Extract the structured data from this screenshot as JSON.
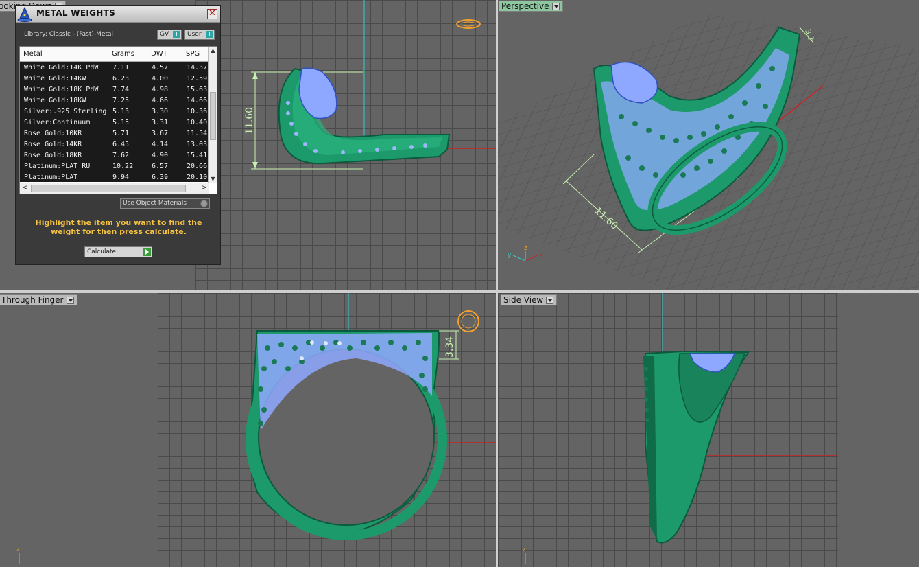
{
  "viewports": {
    "top_left": {
      "label": "ooking Down"
    },
    "top_right": {
      "label": "Perspective"
    },
    "bottom_left": {
      "label": "Through Finger"
    },
    "bottom_right": {
      "label": "Side View"
    }
  },
  "dimensions": {
    "top_view_height": "11.60",
    "perspective_length": "11.60",
    "perspective_corner": "3.3",
    "front_height": "3.34"
  },
  "axes": {
    "x": "x",
    "y": "y",
    "z": "z"
  },
  "panel": {
    "title": "METAL WEIGHTS",
    "close_label": "✕",
    "library_text": "Library: Classic - (Fast)-Metal",
    "gv_label": "GV",
    "user_label": "User",
    "toggle_glyph": "I",
    "columns": [
      "Metal",
      "Grams",
      "DWT",
      "SPG"
    ],
    "rows": [
      [
        "White Gold:14K PdW",
        "7.11",
        "4.57",
        "14.37"
      ],
      [
        "White Gold:14KW",
        "6.23",
        "4.00",
        "12.59"
      ],
      [
        "White Gold:18K PdW",
        "7.74",
        "4.98",
        "15.63"
      ],
      [
        "White Gold:18KW",
        "7.25",
        "4.66",
        "14.66"
      ],
      [
        "Silver:.925 Sterling",
        "5.13",
        "3.30",
        "10.36"
      ],
      [
        "Silver:Continuum",
        "5.15",
        "3.31",
        "10.40"
      ],
      [
        "Rose Gold:10KR",
        "5.71",
        "3.67",
        "11.54"
      ],
      [
        "Rose Gold:14KR",
        "6.45",
        "4.14",
        "13.03"
      ],
      [
        "Rose Gold:18KR",
        "7.62",
        "4.90",
        "15.41"
      ],
      [
        "Platinum:PLAT RU",
        "10.22",
        "6.57",
        "20.66"
      ],
      [
        "Platinum:PLAT",
        "9.94",
        "6.39",
        "20.10"
      ]
    ],
    "use_object_materials": "Use Object Materials",
    "hint": "Highlight the item you want to find the weight for then press calculate.",
    "calculate_label": "Calculate"
  },
  "colors": {
    "ring_metal": "#1d9a6c",
    "gem": "#8fa8ff",
    "dimension": "#c8f0b0",
    "hint": "#f6c341"
  }
}
